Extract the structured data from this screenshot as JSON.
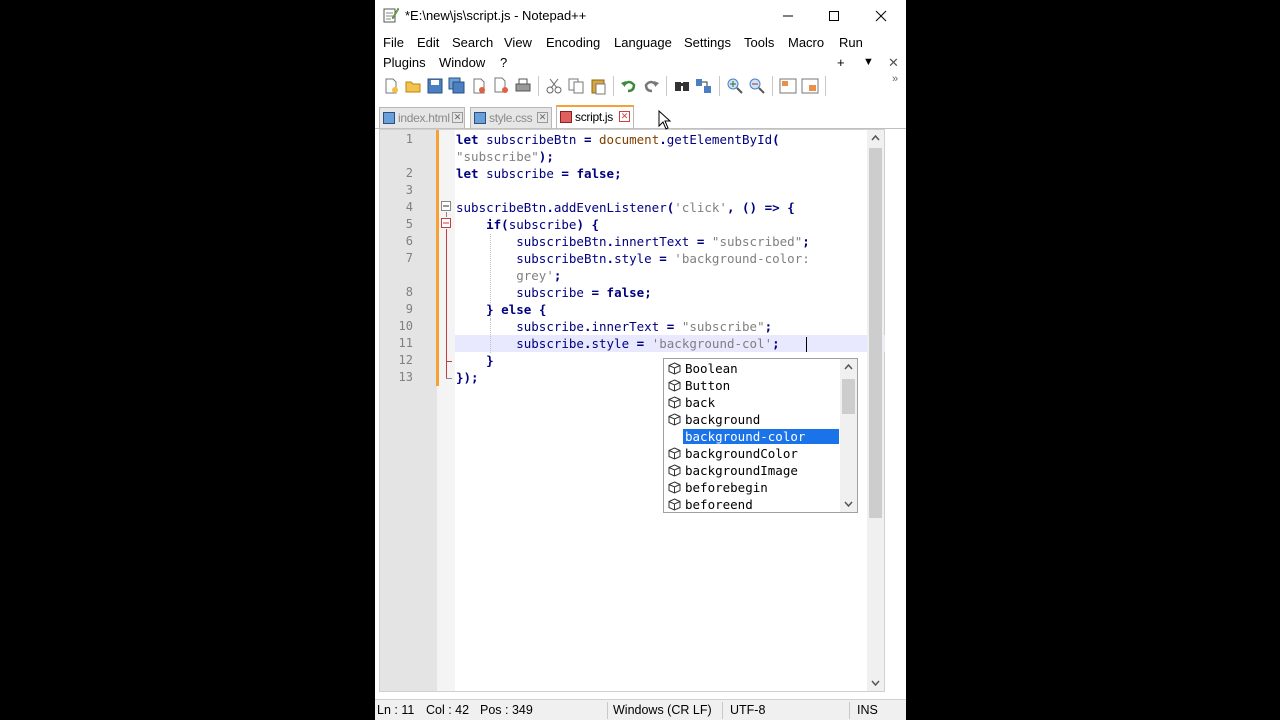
{
  "window": {
    "title": "*E:\\new\\js\\script.js - Notepad++",
    "controls": [
      "minimize",
      "maximize",
      "close"
    ]
  },
  "menu": {
    "row1": [
      "File",
      "Edit",
      "Search",
      "View",
      "Encoding",
      "Language",
      "Settings",
      "Tools",
      "Macro",
      "Run"
    ],
    "row2": [
      "Plugins",
      "Window",
      "?"
    ],
    "right_controls": [
      "+",
      "▼",
      "✕"
    ]
  },
  "tabs": [
    {
      "label": "index.html",
      "active": false
    },
    {
      "label": "style.css",
      "active": false
    },
    {
      "label": "script.js",
      "active": true
    }
  ],
  "editor": {
    "line_numbers": [
      "1",
      "",
      "2",
      "3",
      "4",
      "5",
      "6",
      "7",
      "",
      "8",
      "9",
      "10",
      "11",
      "12",
      "13"
    ],
    "current_line": "11"
  },
  "autocomplete": {
    "items": [
      "Boolean",
      "Button",
      "back",
      "background",
      "background-color",
      "backgroundColor",
      "backgroundImage",
      "beforebegin",
      "beforeend"
    ],
    "selected": "background-color"
  },
  "status": {
    "ln": "Ln : 11",
    "col": "Col : 42",
    "pos": "Pos : 349",
    "eol": "Windows (CR LF)",
    "encoding": "UTF-8",
    "mode": "INS"
  },
  "colors": {
    "keyword": "#000080",
    "string": "#808080",
    "change_bar": "#f7a035",
    "selection": "#1a73e8"
  }
}
